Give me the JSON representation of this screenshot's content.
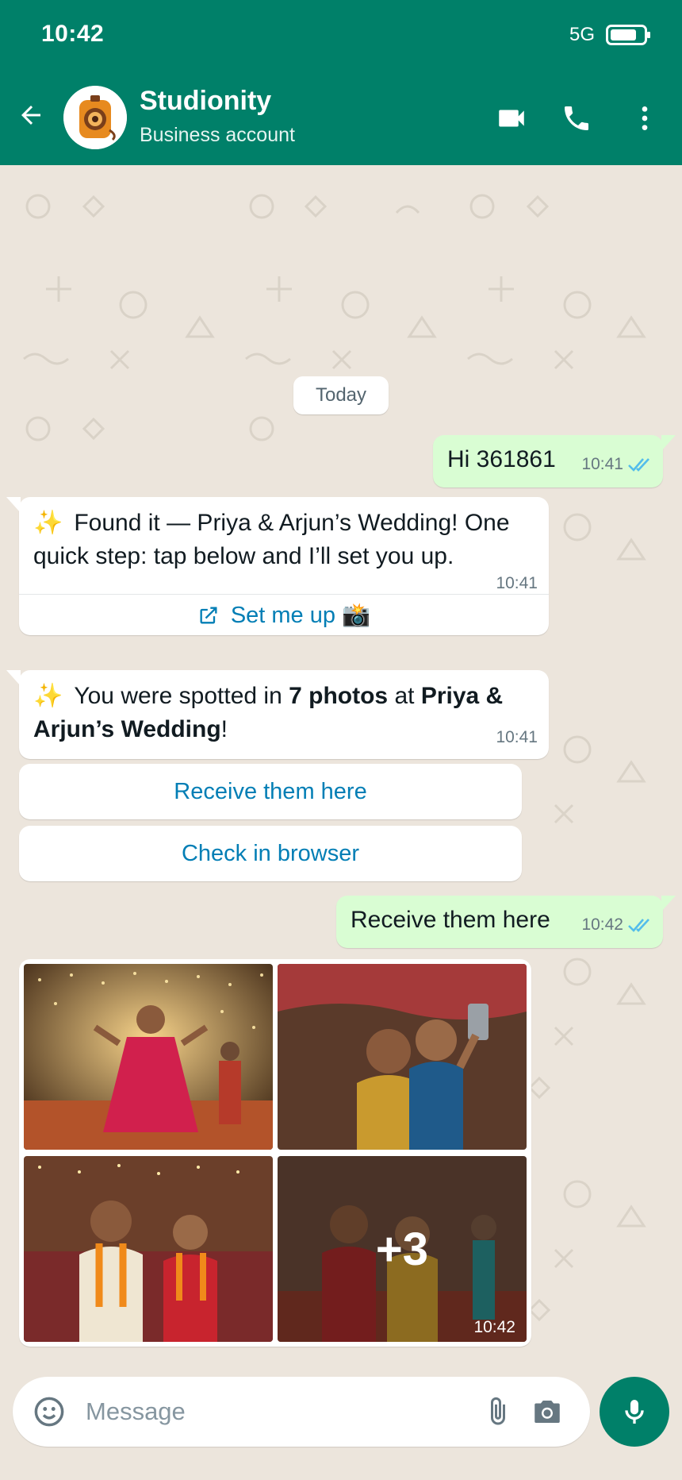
{
  "status_bar": {
    "time": "10:42",
    "network": "5G"
  },
  "header": {
    "name": "Studionity",
    "subtitle": "Business account"
  },
  "chat": {
    "date_chip": "Today",
    "messages": {
      "m1": {
        "text": "Hi 361861",
        "time": "10:41"
      },
      "m2": {
        "emoji": "✨",
        "text": "Found it — Priya & Arjun’s Wedding! One quick step: tap below and I’ll set you up.",
        "time": "10:41",
        "cta_label": "Set me up 📸"
      },
      "m3": {
        "emoji": "✨",
        "part1": "You were spotted in ",
        "bold1": "7 photos",
        "part2": " at ",
        "bold2": "Priya & Arjun’s Wedding",
        "part3": "!",
        "time": "10:41"
      },
      "quick_replies": {
        "r1": "Receive them here",
        "r2": "Check in browser"
      },
      "m4": {
        "text": "Receive them here",
        "time": "10:42"
      },
      "gallery": {
        "photo_count": 4,
        "more_label": "+3",
        "time": "10:42"
      }
    }
  },
  "input": {
    "placeholder": "Message"
  },
  "colors": {
    "header": "#008069",
    "outgoing": "#d9fdd3",
    "incoming": "#ffffff",
    "link": "#027eb5",
    "tick": "#53bdeb",
    "wallpaper": "#ece5dc"
  },
  "icons": [
    "back-arrow-icon",
    "video-call-icon",
    "phone-icon",
    "more-vert-icon",
    "external-link-icon",
    "double-check-icon",
    "emoji-icon",
    "attach-icon",
    "camera-icon",
    "mic-icon",
    "battery-icon"
  ]
}
